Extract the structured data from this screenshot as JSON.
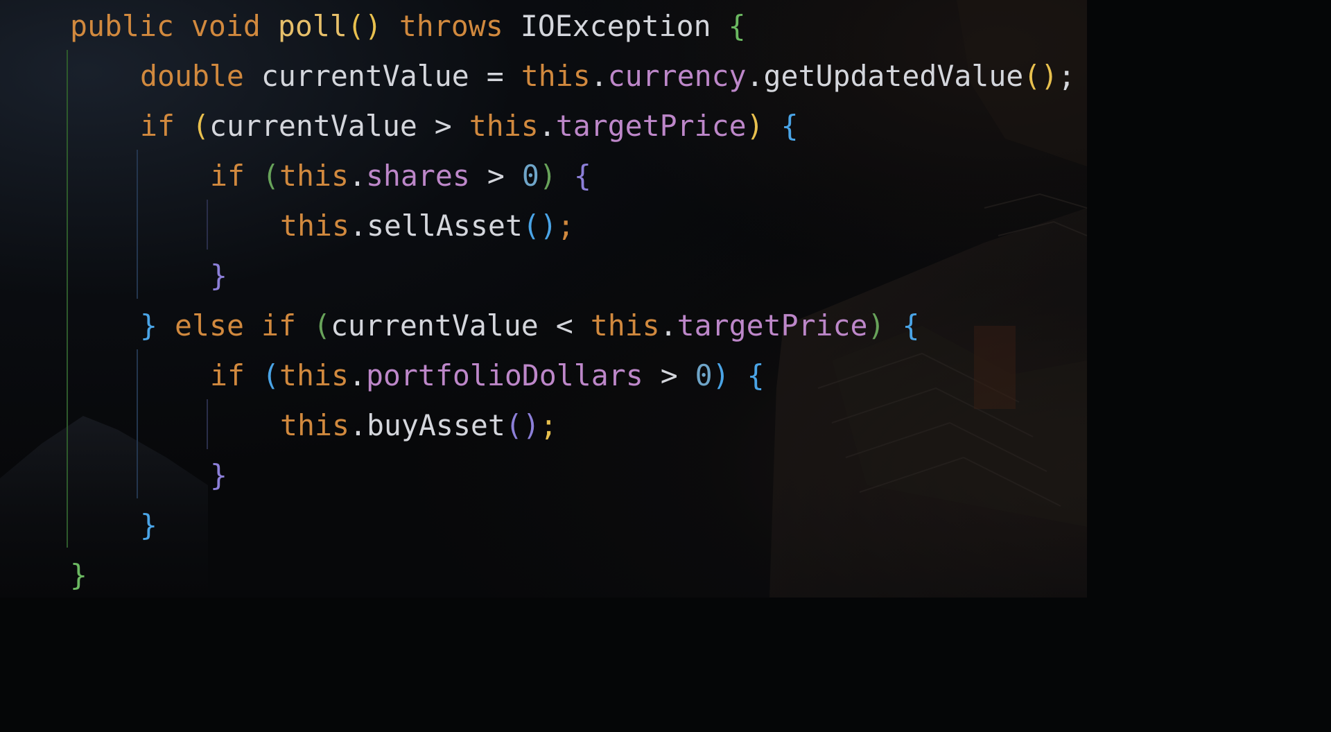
{
  "editor": {
    "language": "java",
    "theme_colors": {
      "keyword": "#d1893e",
      "method": "#e6bf6a",
      "field": "#bd87c9",
      "number": "#6fa5c8",
      "text": "#d4d6dc",
      "bracket_gold": "#e8c04e",
      "bracket_blue": "#4aa4e6",
      "bracket_green": "#68a35a",
      "bracket_purple": "#8c7fd8"
    },
    "lines": [
      {
        "indent": 1,
        "tokens": [
          {
            "t": "public",
            "c": "kw"
          },
          {
            "t": " ",
            "c": "plain"
          },
          {
            "t": "void",
            "c": "kw"
          },
          {
            "t": " ",
            "c": "plain"
          },
          {
            "t": "poll",
            "c": "fn"
          },
          {
            "t": "()",
            "c": "b1"
          },
          {
            "t": " ",
            "c": "plain"
          },
          {
            "t": "throws",
            "c": "kw"
          },
          {
            "t": " ",
            "c": "plain"
          },
          {
            "t": "IOException",
            "c": "cls"
          },
          {
            "t": " ",
            "c": "plain"
          },
          {
            "t": "{",
            "c": "bgreen"
          }
        ]
      },
      {
        "indent": 2,
        "tokens": [
          {
            "t": "double",
            "c": "kw"
          },
          {
            "t": " currentValue = ",
            "c": "plain"
          },
          {
            "t": "this",
            "c": "kw"
          },
          {
            "t": ".",
            "c": "plain"
          },
          {
            "t": "currency",
            "c": "fld"
          },
          {
            "t": ".getUpdatedValue",
            "c": "plain"
          },
          {
            "t": "()",
            "c": "b1"
          },
          {
            "t": ";",
            "c": "plain"
          }
        ]
      },
      {
        "indent": 2,
        "tokens": [
          {
            "t": "if",
            "c": "kw"
          },
          {
            "t": " ",
            "c": "plain"
          },
          {
            "t": "(",
            "c": "b1"
          },
          {
            "t": "currentValue > ",
            "c": "plain"
          },
          {
            "t": "this",
            "c": "kw"
          },
          {
            "t": ".",
            "c": "plain"
          },
          {
            "t": "targetPrice",
            "c": "fld"
          },
          {
            "t": ")",
            "c": "b1"
          },
          {
            "t": " ",
            "c": "plain"
          },
          {
            "t": "{",
            "c": "b2"
          }
        ]
      },
      {
        "indent": 3,
        "tokens": [
          {
            "t": "if",
            "c": "kw"
          },
          {
            "t": " ",
            "c": "plain"
          },
          {
            "t": "(",
            "c": "b3"
          },
          {
            "t": "this",
            "c": "kw"
          },
          {
            "t": ".",
            "c": "plain"
          },
          {
            "t": "shares",
            "c": "fld"
          },
          {
            "t": " > ",
            "c": "plain"
          },
          {
            "t": "0",
            "c": "num"
          },
          {
            "t": ")",
            "c": "b3"
          },
          {
            "t": " ",
            "c": "plain"
          },
          {
            "t": "{",
            "c": "b4"
          }
        ]
      },
      {
        "indent": 4,
        "tokens": [
          {
            "t": "this",
            "c": "kw"
          },
          {
            "t": ".sellAsset",
            "c": "plain"
          },
          {
            "t": "()",
            "c": "b2"
          },
          {
            "t": ";",
            "c": "kw"
          }
        ]
      },
      {
        "indent": 3,
        "tokens": [
          {
            "t": "}",
            "c": "b4"
          }
        ]
      },
      {
        "indent": 2,
        "tokens": [
          {
            "t": "}",
            "c": "b2"
          },
          {
            "t": " ",
            "c": "plain"
          },
          {
            "t": "else",
            "c": "kw"
          },
          {
            "t": " ",
            "c": "plain"
          },
          {
            "t": "if",
            "c": "kw"
          },
          {
            "t": " ",
            "c": "plain"
          },
          {
            "t": "(",
            "c": "b3"
          },
          {
            "t": "currentValue < ",
            "c": "plain"
          },
          {
            "t": "this",
            "c": "kw"
          },
          {
            "t": ".",
            "c": "plain"
          },
          {
            "t": "targetPrice",
            "c": "fld"
          },
          {
            "t": ")",
            "c": "b3"
          },
          {
            "t": " ",
            "c": "plain"
          },
          {
            "t": "{",
            "c": "b2"
          }
        ]
      },
      {
        "indent": 3,
        "tokens": [
          {
            "t": "if",
            "c": "kw"
          },
          {
            "t": " ",
            "c": "plain"
          },
          {
            "t": "(",
            "c": "b2"
          },
          {
            "t": "this",
            "c": "kw"
          },
          {
            "t": ".",
            "c": "plain"
          },
          {
            "t": "portfolioDollars",
            "c": "fld"
          },
          {
            "t": " > ",
            "c": "plain"
          },
          {
            "t": "0",
            "c": "num"
          },
          {
            "t": ")",
            "c": "b2"
          },
          {
            "t": " ",
            "c": "plain"
          },
          {
            "t": "{",
            "c": "b2"
          }
        ]
      },
      {
        "indent": 4,
        "tokens": [
          {
            "t": "this",
            "c": "kw"
          },
          {
            "t": ".buyAsset",
            "c": "plain"
          },
          {
            "t": "()",
            "c": "b4"
          },
          {
            "t": ";",
            "c": "b1"
          }
        ]
      },
      {
        "indent": 3,
        "tokens": [
          {
            "t": "}",
            "c": "b4"
          }
        ]
      },
      {
        "indent": 2,
        "tokens": [
          {
            "t": "}",
            "c": "b2"
          }
        ]
      },
      {
        "indent": 1,
        "tokens": [
          {
            "t": "}",
            "c": "bgreen"
          }
        ]
      }
    ]
  }
}
